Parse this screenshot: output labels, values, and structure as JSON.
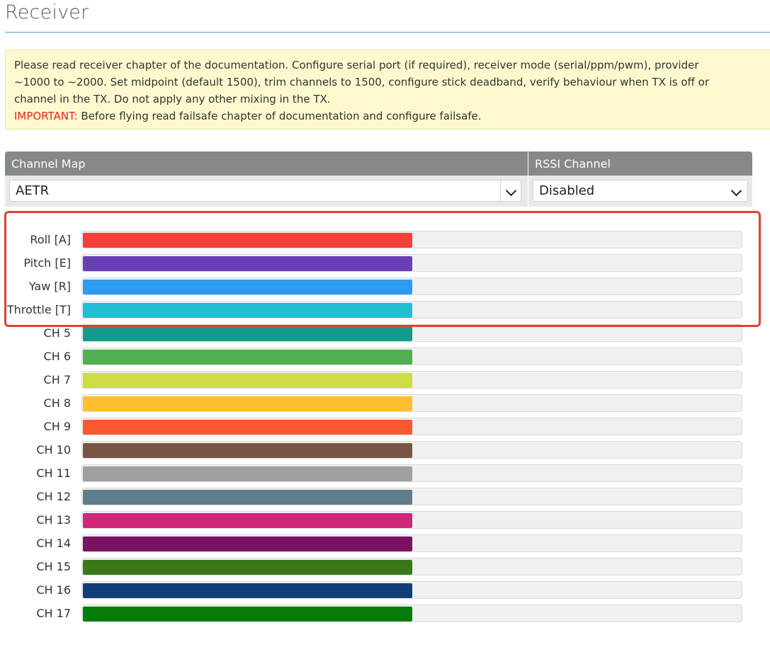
{
  "page": {
    "title": "Receiver"
  },
  "note": {
    "line1": "Please read receiver chapter of the documentation. Configure serial port (if required), receiver mode (serial/ppm/pwm), provider",
    "line2": "~1000 to ~2000. Set midpoint (default 1500), trim channels to 1500, configure stick deadband, verify behaviour when TX is off or",
    "line3": "channel in the TX. Do not apply any other mixing in the TX.",
    "important_label": "IMPORTANT:",
    "important_text": " Before flying read failsafe chapter of documentation and configure failsafe."
  },
  "channel_map": {
    "header": "Channel Map",
    "selected": "AETR"
  },
  "rssi_channel": {
    "header": "RSSI Channel",
    "selected": "Disabled"
  },
  "channels": [
    {
      "label": "Roll [A]",
      "color": "#f4403a",
      "fill_fraction": 0.5
    },
    {
      "label": "Pitch [E]",
      "color": "#6a3fb5",
      "fill_fraction": 0.5
    },
    {
      "label": "Yaw [R]",
      "color": "#2d9bf0",
      "fill_fraction": 0.5
    },
    {
      "label": "Throttle [T]",
      "color": "#22bed4",
      "fill_fraction": 0.5
    },
    {
      "label": "CH 5",
      "color": "#159a8a",
      "fill_fraction": 0.5
    },
    {
      "label": "CH 6",
      "color": "#4fb050",
      "fill_fraction": 0.5
    },
    {
      "label": "CH 7",
      "color": "#cfdc45",
      "fill_fraction": 0.5
    },
    {
      "label": "CH 8",
      "color": "#fdbf2d",
      "fill_fraction": 0.5
    },
    {
      "label": "CH 9",
      "color": "#fe5630",
      "fill_fraction": 0.5
    },
    {
      "label": "CH 10",
      "color": "#795546",
      "fill_fraction": 0.5
    },
    {
      "label": "CH 11",
      "color": "#9f9f9f",
      "fill_fraction": 0.5
    },
    {
      "label": "CH 12",
      "color": "#5f7c8a",
      "fill_fraction": 0.5
    },
    {
      "label": "CH 13",
      "color": "#d02779",
      "fill_fraction": 0.5
    },
    {
      "label": "CH 14",
      "color": "#7b1163",
      "fill_fraction": 0.5
    },
    {
      "label": "CH 15",
      "color": "#3a7818",
      "fill_fraction": 0.5
    },
    {
      "label": "CH 16",
      "color": "#123e78",
      "fill_fraction": 0.5
    },
    {
      "label": "CH 17",
      "color": "#067d09",
      "fill_fraction": 0.5
    }
  ],
  "highlight": {
    "color": "#e0402f",
    "covers": [
      "Roll [A]",
      "Pitch [E]",
      "Yaw [R]",
      "Throttle [T]"
    ]
  }
}
